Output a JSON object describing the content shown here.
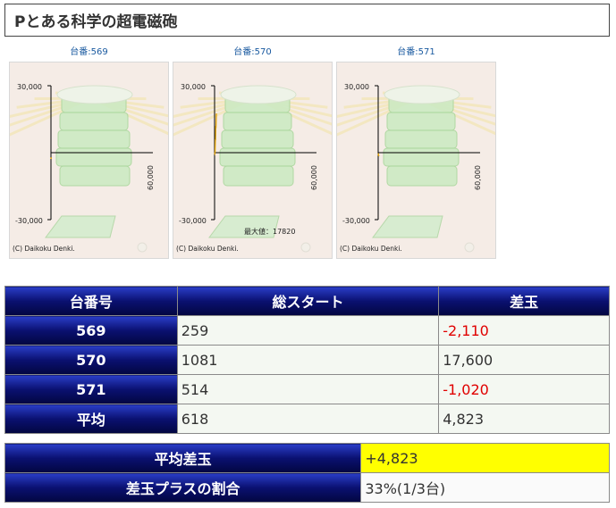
{
  "title": "Pとある科学の超電磁砲",
  "charts": [
    {
      "label": "台番:569",
      "y_top": "30,000",
      "y_bottom": "-30,000",
      "x_right": "60,000",
      "copyright": "(C) Daikoku Denki.",
      "max_text": "",
      "line_points": [
        [
          0,
          -2200
        ],
        [
          40,
          -2800
        ],
        [
          120,
          -2500
        ],
        [
          259,
          -2110
        ]
      ]
    },
    {
      "label": "台番:570",
      "y_top": "30,000",
      "y_bottom": "-30,000",
      "x_right": "60,000",
      "copyright": "(C) Daikoku Denki.",
      "max_text": "最大値：17820",
      "line_points": [
        [
          0,
          -200
        ],
        [
          150,
          -500
        ],
        [
          300,
          200
        ],
        [
          450,
          6000
        ],
        [
          560,
          5500
        ],
        [
          700,
          12000
        ],
        [
          820,
          11000
        ],
        [
          950,
          15000
        ],
        [
          1081,
          17600
        ]
      ]
    },
    {
      "label": "台番:571",
      "y_top": "30,000",
      "y_bottom": "-30,000",
      "x_right": "60,000",
      "copyright": "(C) Daikoku Denki.",
      "max_text": "",
      "line_points": [
        [
          0,
          -300
        ],
        [
          120,
          -600
        ],
        [
          260,
          -1500
        ],
        [
          400,
          -1200
        ],
        [
          514,
          -1020
        ]
      ]
    }
  ],
  "table1": {
    "headers": [
      "台番号",
      "総スタート",
      "差玉"
    ],
    "rows": [
      {
        "id": "569",
        "start": "259",
        "diff": "-2,110",
        "neg": true
      },
      {
        "id": "570",
        "start": "1081",
        "diff": "17,600",
        "neg": false
      },
      {
        "id": "571",
        "start": "514",
        "diff": "-1,020",
        "neg": true
      },
      {
        "id": "平均",
        "start": "618",
        "diff": "4,823",
        "neg": false
      }
    ]
  },
  "table2": {
    "avg_label": "平均差玉",
    "avg_value": "+4,823",
    "ratio_label": "差玉プラスの割合",
    "ratio_value": "33%(1/3台)"
  },
  "colors": {
    "header_blue": "#0a1070",
    "negative_red": "#e00000",
    "highlight_yellow": "#ffff00",
    "line_orange": "#e0a000"
  }
}
